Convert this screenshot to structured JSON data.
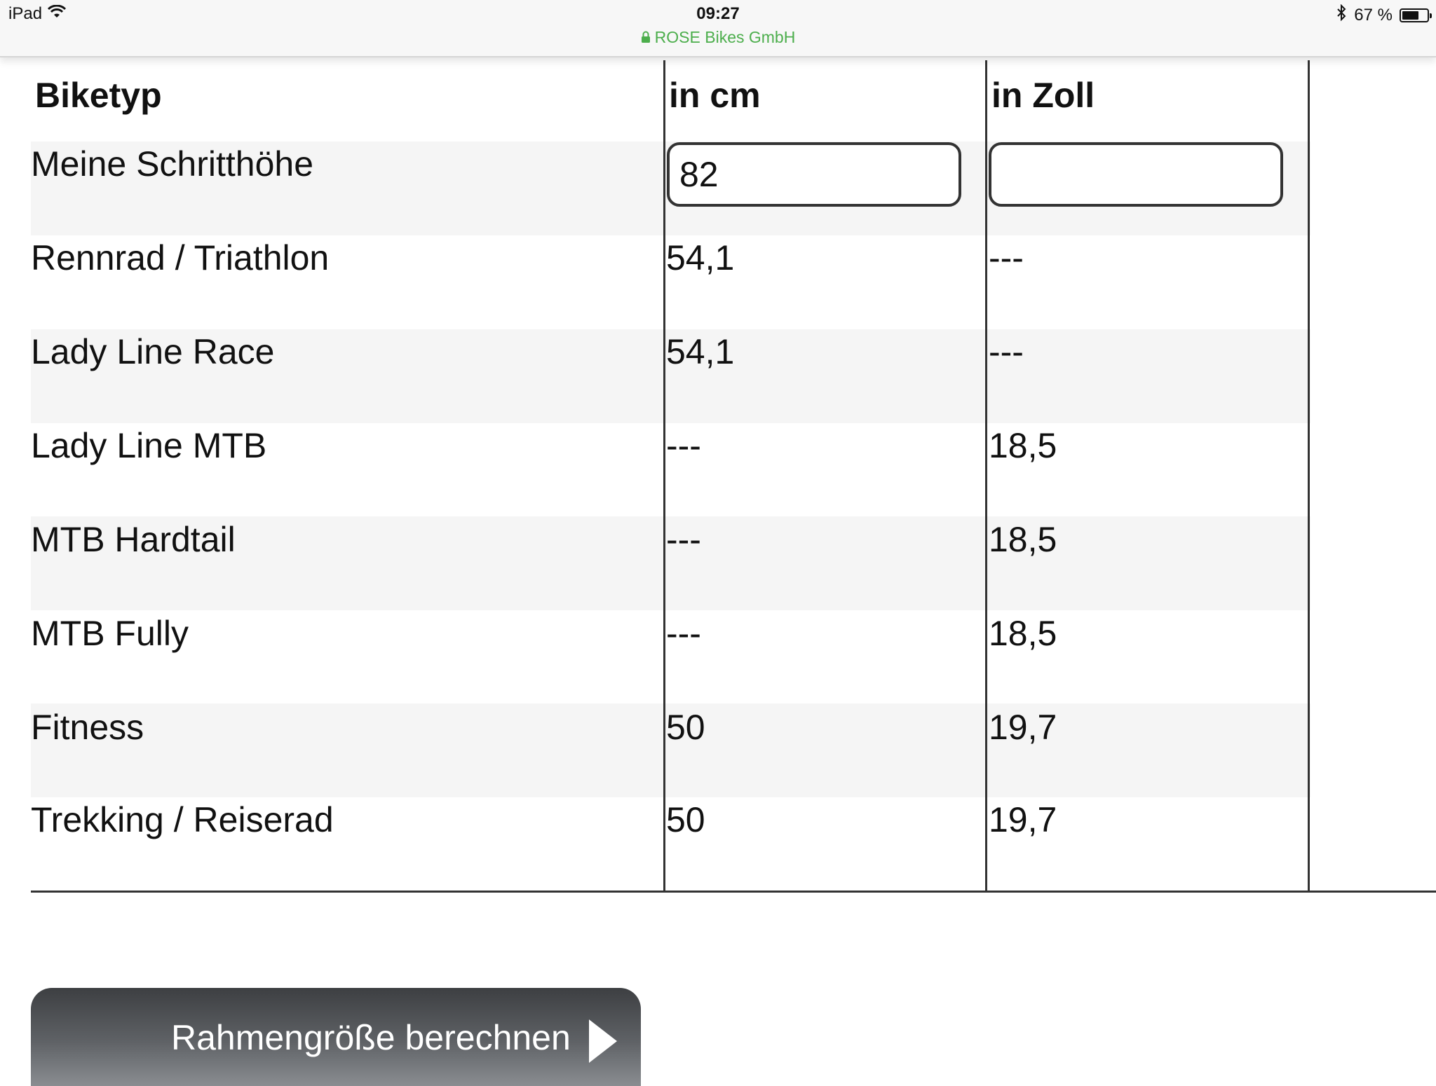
{
  "status_bar": {
    "device": "iPad",
    "time": "09:27",
    "url": "ROSE Bikes GmbH",
    "battery": "67 %",
    "battery_level": 0.67,
    "icons": [
      "wifi-icon",
      "lock-icon",
      "bluetooth-icon",
      "battery-icon"
    ]
  },
  "table": {
    "headers": {
      "biketyp": "Biketyp",
      "cm": "in cm",
      "zoll": "in Zoll"
    },
    "input_row": {
      "label": "Meine Schritthöhe",
      "cm_value": "82",
      "zoll_value": ""
    },
    "rows": [
      {
        "label": "Rennrad / Triathlon",
        "cm": "54,1",
        "zoll": "---"
      },
      {
        "label": "Lady Line Race",
        "cm": "54,1",
        "zoll": "---"
      },
      {
        "label": "Lady Line MTB",
        "cm": "---",
        "zoll": "18,5"
      },
      {
        "label": "MTB Hardtail",
        "cm": "---",
        "zoll": "18,5"
      },
      {
        "label": "MTB Fully",
        "cm": "---",
        "zoll": "18,5"
      },
      {
        "label": "Fitness",
        "cm": "50",
        "zoll": "19,7"
      },
      {
        "label": "Trekking / Reiserad",
        "cm": "50",
        "zoll": "19,7"
      }
    ]
  },
  "button": {
    "label": "Rahmengröße berechnen",
    "icon": "play-arrow-icon"
  },
  "colors": {
    "url_green": "#4cae4c",
    "stripe": "#f5f5f5",
    "rule": "#333333"
  }
}
